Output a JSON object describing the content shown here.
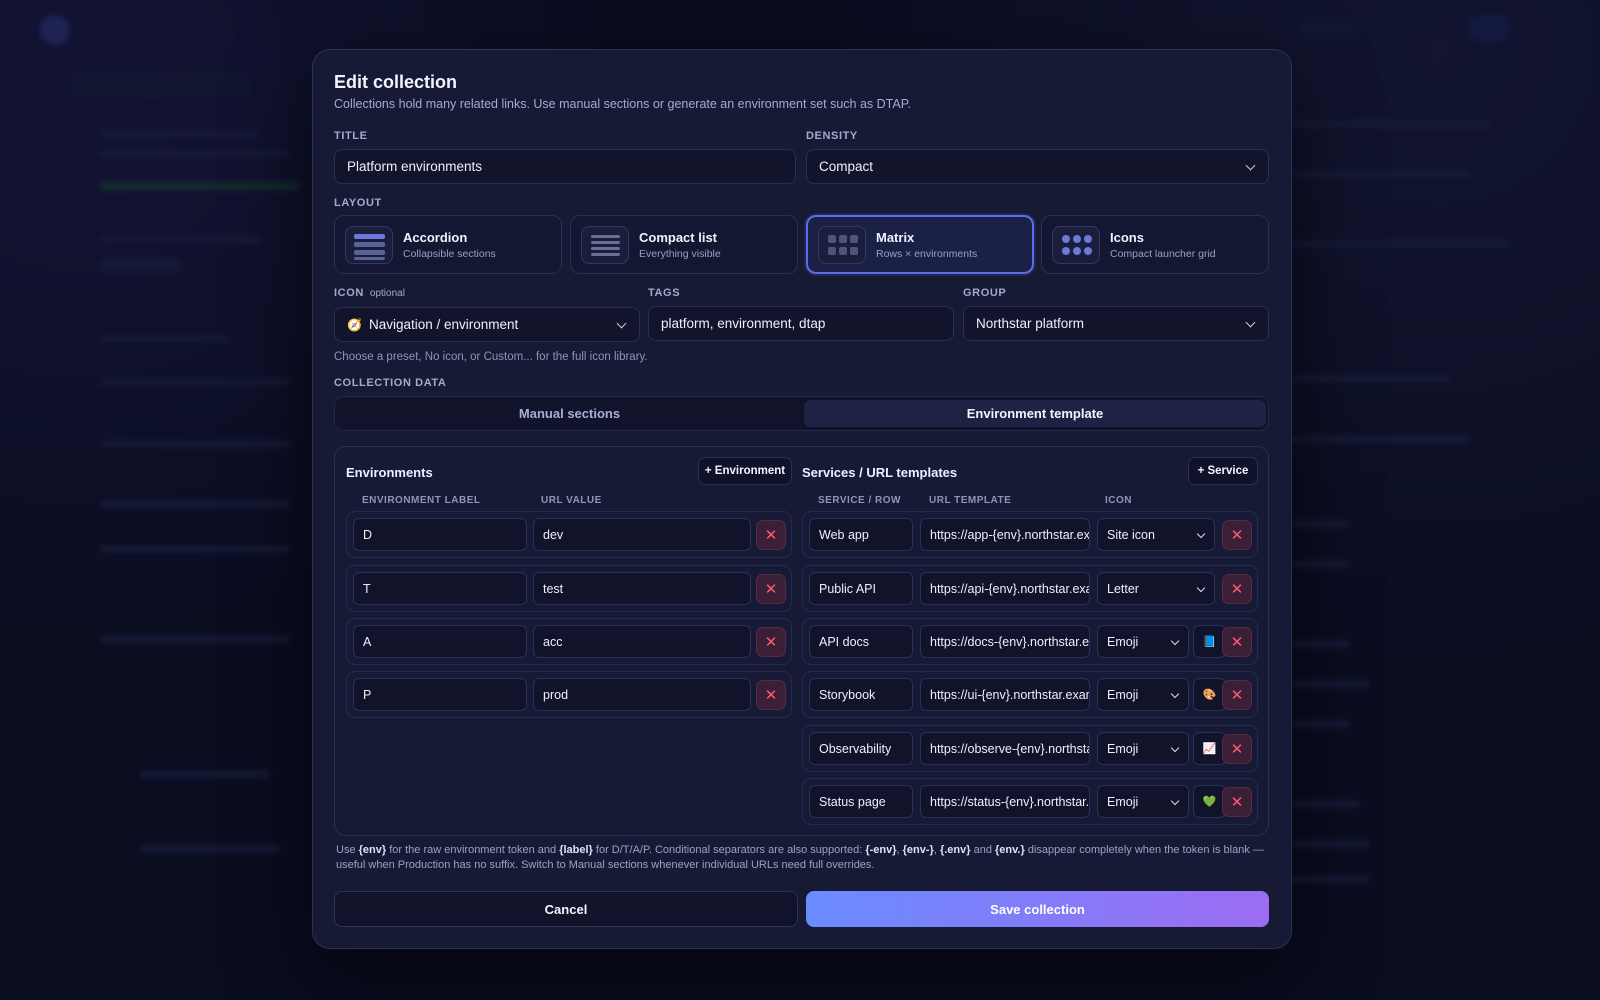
{
  "modal": {
    "title": "Edit collection",
    "subtitle": "Collections hold many related links. Use manual sections or generate an environment set such as DTAP."
  },
  "fields": {
    "title_label": "TITLE",
    "title_value": "Platform environments",
    "density_label": "DENSITY",
    "density_value": "Compact",
    "layout_label": "LAYOUT",
    "icon_label": "ICON",
    "icon_optional": "optional",
    "icon_value": "Navigation / environment",
    "icon_glyph": "🧭",
    "tags_label": "TAGS",
    "tags_value": "platform, environment, dtap",
    "group_label": "GROUP",
    "group_value": "Northstar platform",
    "icon_hint": "Choose a preset, No icon, or Custom... for the full icon library.",
    "collection_data_label": "COLLECTION DATA"
  },
  "layouts": [
    {
      "title": "Accordion",
      "subtitle": "Collapsible sections",
      "selected": false
    },
    {
      "title": "Compact list",
      "subtitle": "Everything visible",
      "selected": false
    },
    {
      "title": "Matrix",
      "subtitle": "Rows × environments",
      "selected": true
    },
    {
      "title": "Icons",
      "subtitle": "Compact launcher grid",
      "selected": false
    }
  ],
  "tabs": {
    "manual": "Manual sections",
    "template": "Environment template",
    "active": "template"
  },
  "environments": {
    "heading": "Environments",
    "add_label": "+ Environment",
    "col_label": "ENVIRONMENT LABEL",
    "col_value": "URL VALUE",
    "rows": [
      {
        "label": "D",
        "value": "dev"
      },
      {
        "label": "T",
        "value": "test"
      },
      {
        "label": "A",
        "value": "acc"
      },
      {
        "label": "P",
        "value": "prod"
      }
    ]
  },
  "services": {
    "heading": "Services / URL templates",
    "add_label": "+ Service",
    "col_row": "SERVICE / ROW",
    "col_template": "URL TEMPLATE",
    "col_icon": "ICON",
    "rows": [
      {
        "name": "Web app",
        "template": "https://app-{env}.northstar.example",
        "icon": "Site icon",
        "emoji": ""
      },
      {
        "name": "Public API",
        "template": "https://api-{env}.northstar.example",
        "icon": "Letter",
        "emoji": ""
      },
      {
        "name": "API docs",
        "template": "https://docs-{env}.northstar.example",
        "icon": "Emoji",
        "emoji": "📘"
      },
      {
        "name": "Storybook",
        "template": "https://ui-{env}.northstar.example",
        "icon": "Emoji",
        "emoji": "🎨"
      },
      {
        "name": "Observability",
        "template": "https://observe-{env}.northstar.example",
        "icon": "Emoji",
        "emoji": "📈"
      },
      {
        "name": "Status page",
        "template": "https://status-{env}.northstar.example",
        "icon": "Emoji",
        "emoji": "💚"
      }
    ]
  },
  "note": {
    "p1": "Use ",
    "env_token": "{env}",
    "p2": " for the raw environment token and ",
    "label_token": "{label}",
    "p3": " for D/T/A/P. Conditional separators are also supported: ",
    "sep1": "{-env}",
    "c1": ", ",
    "sep2": "{env-}",
    "c2": ", ",
    "sep3": "{.env}",
    "c3": " and ",
    "sep4": "{env.}",
    "p4": " disappear completely when the token is blank — useful when Production has no suffix. Switch to Manual sections whenever individual URLs need full overrides."
  },
  "actions": {
    "cancel": "Cancel",
    "save": "Save collection"
  },
  "colors": {
    "accent": "#5b6ee8",
    "save_gradient_start": "#6a8cff",
    "save_gradient_end": "#9c6cf2",
    "danger": "#ff5a78"
  }
}
